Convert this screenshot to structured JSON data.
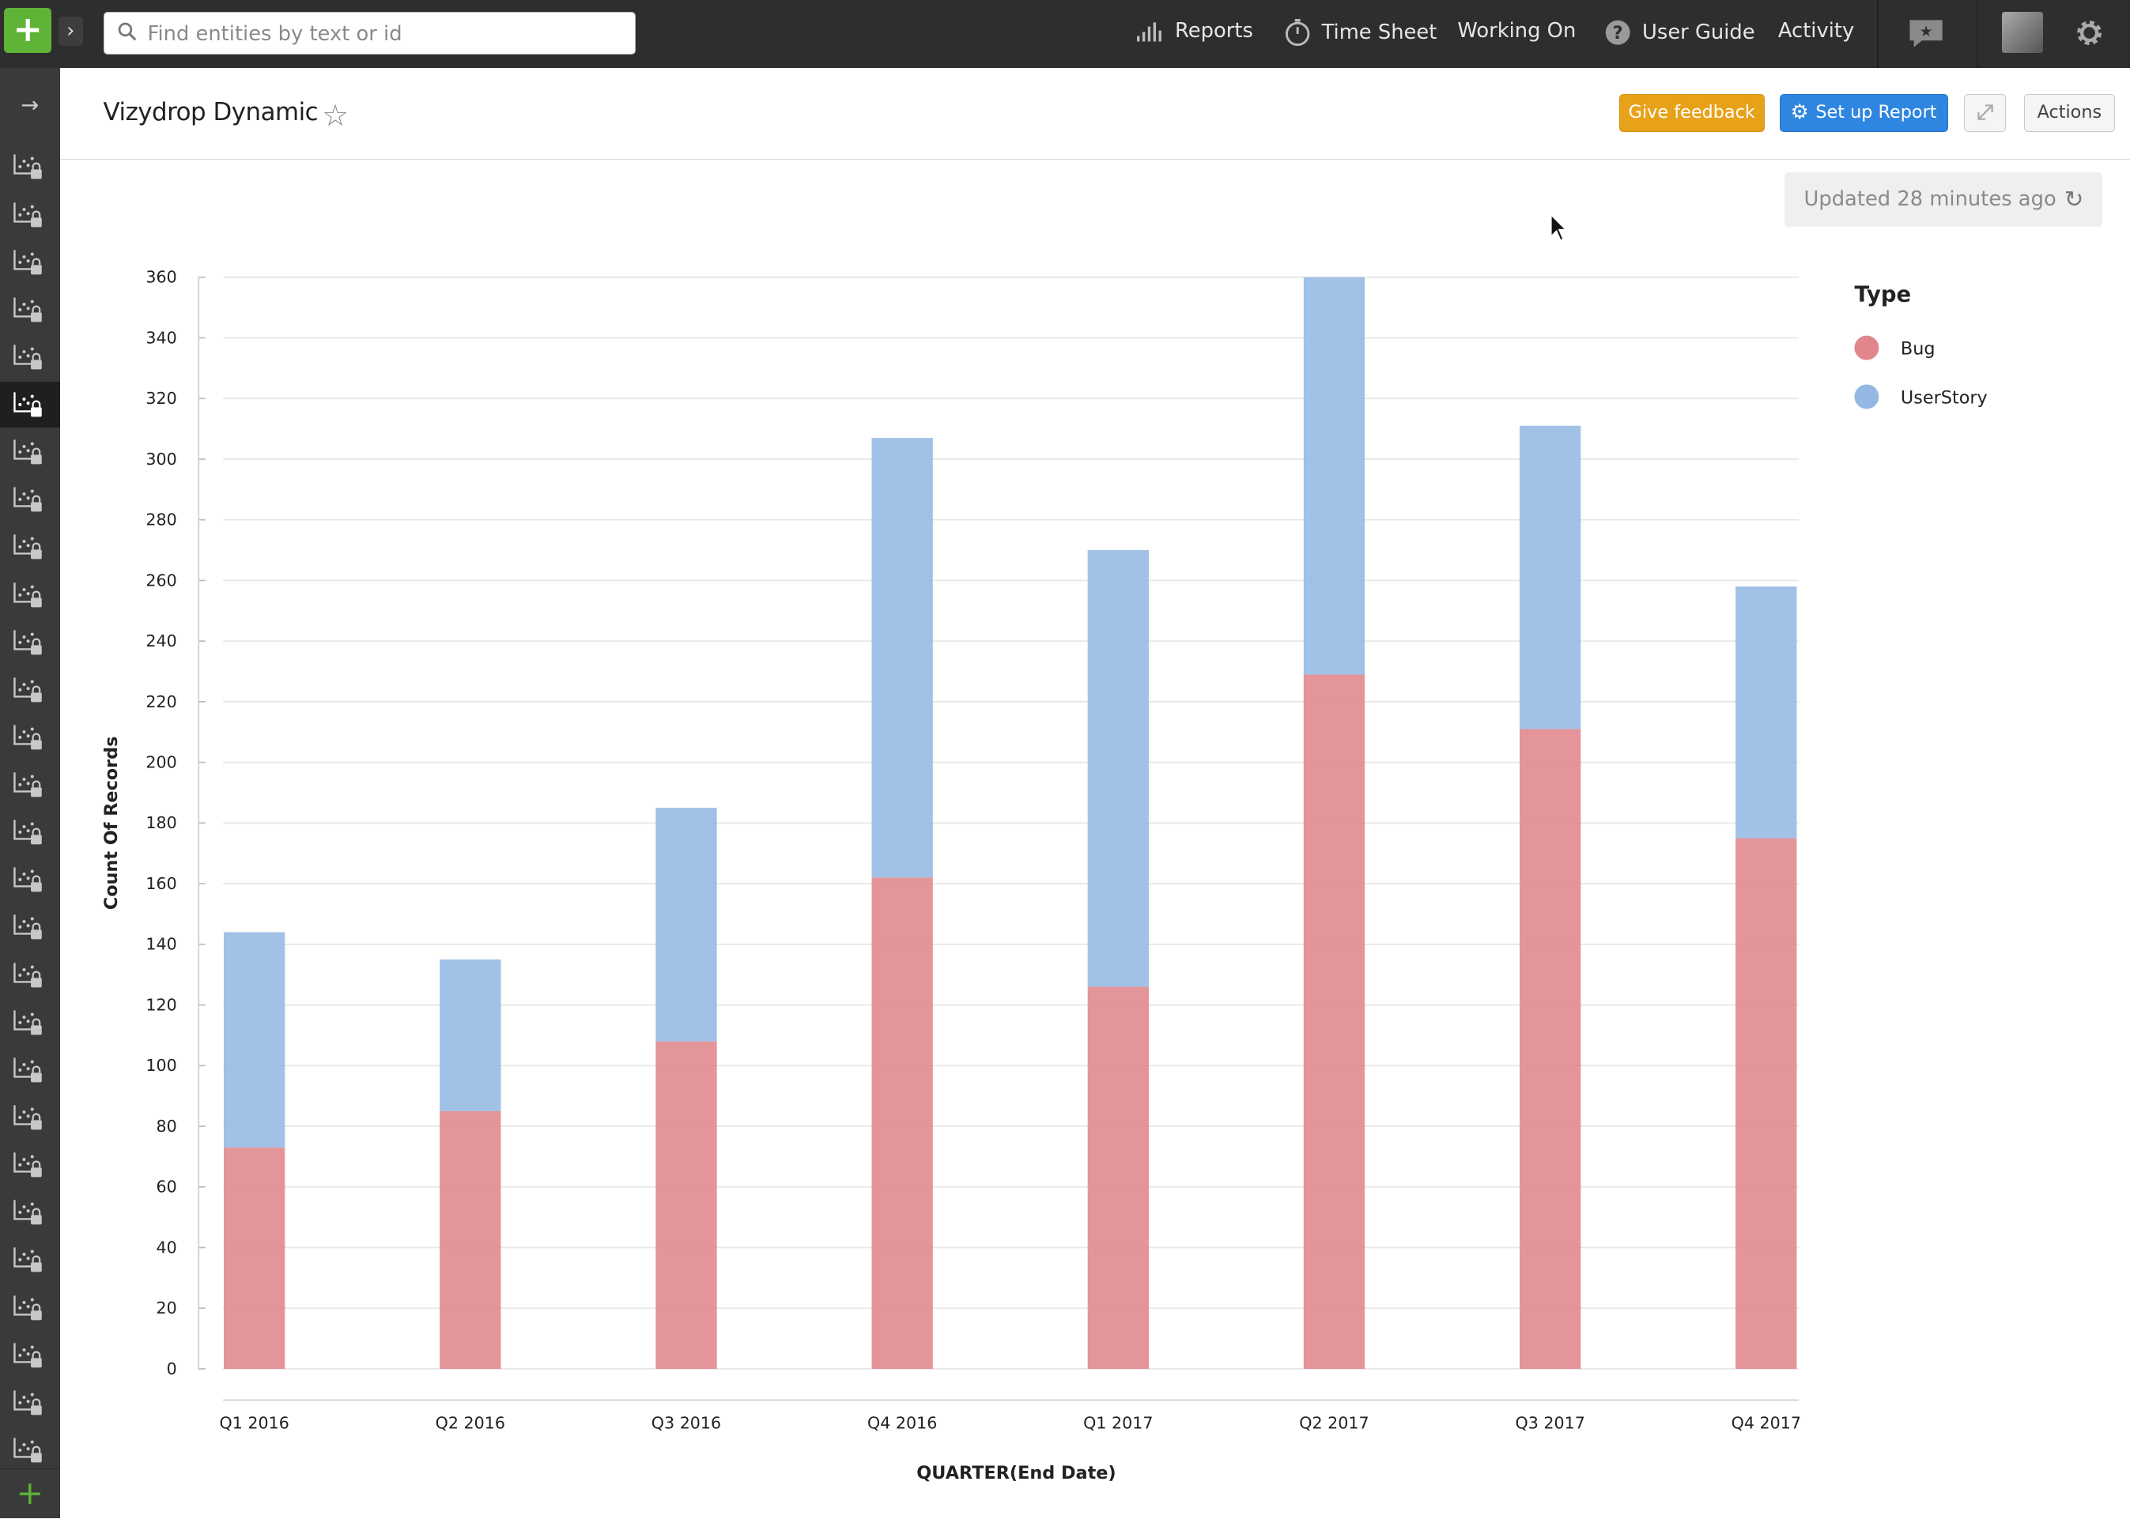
{
  "topbar": {
    "search_placeholder": "Find entities by text or id",
    "nav": [
      {
        "label": "Reports",
        "icon": "bar-chart-icon"
      },
      {
        "label": "Time Sheet",
        "icon": "stopwatch-icon"
      },
      {
        "label": "Working On",
        "icon": ""
      },
      {
        "label": "User Guide",
        "icon": "help-icon"
      },
      {
        "label": "Activity",
        "icon": ""
      }
    ]
  },
  "sidebar": {
    "report_icon_count": 28,
    "active_index": 5
  },
  "header": {
    "title": "Vizydrop Dynamic",
    "feedback_label": "Give feedback",
    "setup_label": "Set up Report",
    "actions_label": "Actions"
  },
  "status": {
    "updated_text": "Updated 28 minutes ago"
  },
  "colors": {
    "accent_green": "#5fb336",
    "feedback_orange": "#e8a21a",
    "setup_blue": "#2f86e0",
    "bug": "#e0868c",
    "userstory": "#94b8e3"
  },
  "chart_data": {
    "type": "bar",
    "stacked": true,
    "categories": [
      "Q1 2016",
      "Q2 2016",
      "Q3 2016",
      "Q4 2016",
      "Q1 2017",
      "Q2 2017",
      "Q3 2017",
      "Q4 2017"
    ],
    "series": [
      {
        "name": "Bug",
        "color": "#e0868c",
        "values": [
          73,
          85,
          108,
          162,
          126,
          229,
          211,
          175
        ]
      },
      {
        "name": "UserStory",
        "color": "#94b8e3",
        "values": [
          71,
          50,
          77,
          145,
          144,
          131,
          100,
          83
        ]
      }
    ],
    "xlabel": "QUARTER(End Date)",
    "ylabel": "Count Of Records",
    "ylim": [
      0,
      360
    ],
    "yticks": [
      0,
      20,
      40,
      60,
      80,
      100,
      120,
      140,
      160,
      180,
      200,
      220,
      240,
      260,
      280,
      300,
      320,
      340,
      360
    ],
    "legend_title": "Type",
    "legend_position": "right",
    "grid": true
  }
}
